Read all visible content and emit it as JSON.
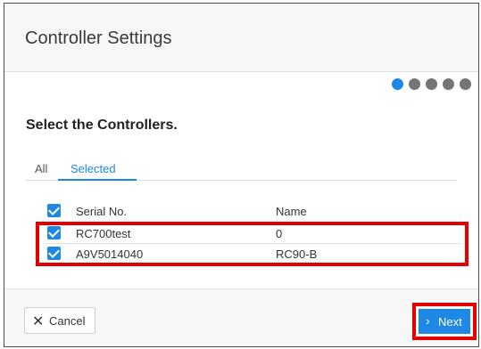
{
  "dialog": {
    "title": "Controller Settings"
  },
  "wizard": {
    "total_steps": 5,
    "current_step": 1
  },
  "section": {
    "heading": "Select the Controllers."
  },
  "tabs": {
    "all": "All",
    "selected": "Selected",
    "active": "Selected"
  },
  "table": {
    "columns": {
      "serial": "Serial No.",
      "name": "Name"
    },
    "select_all_checked": true,
    "rows": [
      {
        "serial": "RC700test",
        "name": "0",
        "checked": true
      },
      {
        "serial": "A9V5014040",
        "name": "RC90-B",
        "checked": true
      }
    ]
  },
  "footer": {
    "cancel_label": "Cancel",
    "next_label": "Next"
  },
  "colors": {
    "accent": "#1e88e5",
    "highlight": "#e30000",
    "step_inactive": "#757575"
  }
}
